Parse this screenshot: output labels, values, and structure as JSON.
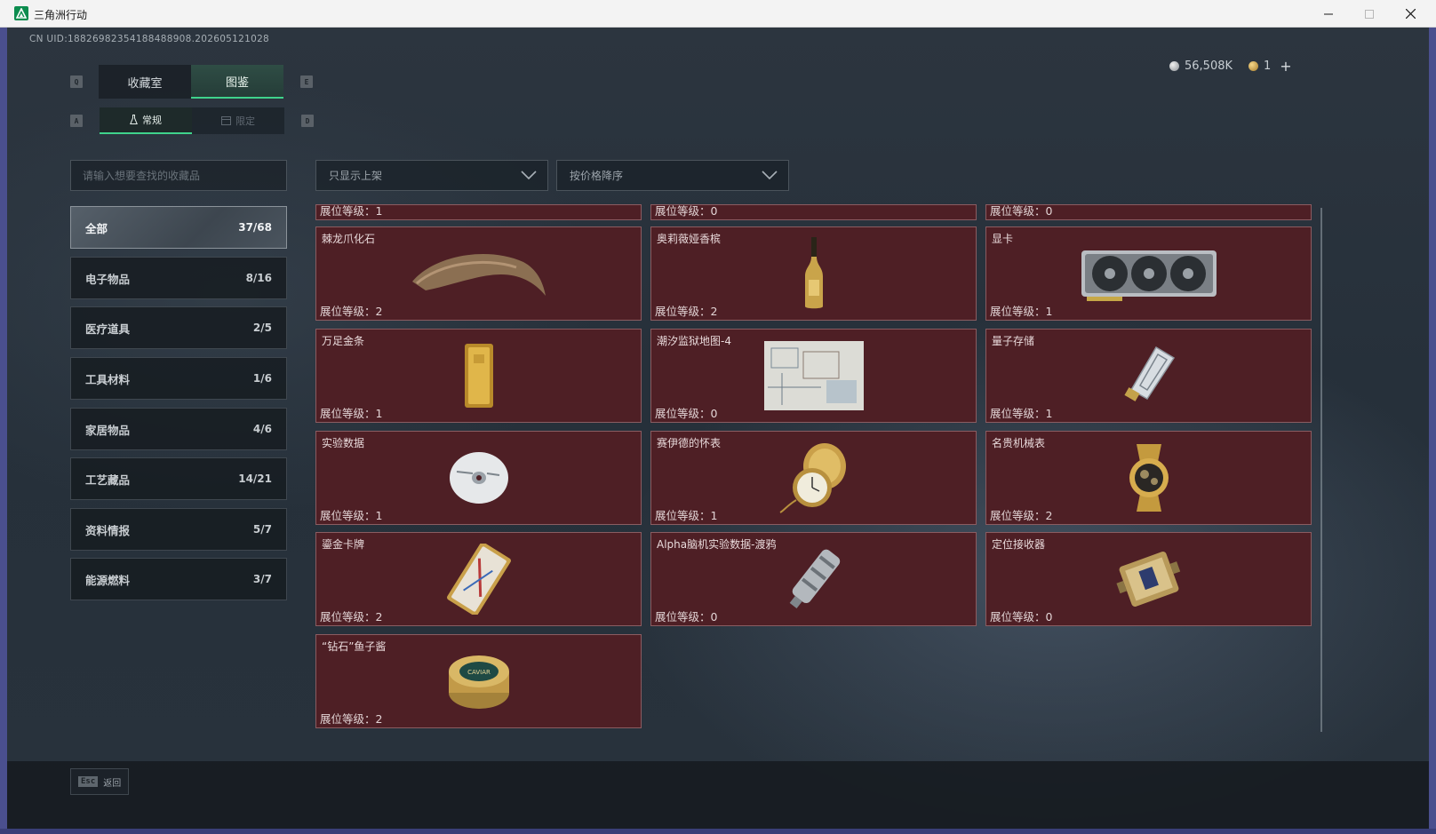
{
  "window": {
    "title": "三角洲行动"
  },
  "header": {
    "uid": "CN UID:18826982354188488908.202605121028",
    "currency_silver": "56,508K",
    "currency_gold": "1",
    "plus": "+"
  },
  "tabs": {
    "main": [
      {
        "label": "收藏室"
      },
      {
        "label": "图鉴"
      }
    ],
    "sub": [
      {
        "label": "常规"
      },
      {
        "label": "限定"
      }
    ],
    "keys": {
      "q": "Q",
      "e": "E",
      "a": "A",
      "d": "D"
    }
  },
  "search": {
    "placeholder": "请输入想要查找的收藏品"
  },
  "filters": {
    "display": "只显示上架",
    "sort": "按价格降序"
  },
  "categories": [
    {
      "label": "全部",
      "count": "37/68"
    },
    {
      "label": "电子物品",
      "count": "8/16"
    },
    {
      "label": "医疗道具",
      "count": "2/5"
    },
    {
      "label": "工具材料",
      "count": "1/6"
    },
    {
      "label": "家居物品",
      "count": "4/6"
    },
    {
      "label": "工艺藏品",
      "count": "14/21"
    },
    {
      "label": "资料情报",
      "count": "5/7"
    },
    {
      "label": "能源燃料",
      "count": "3/7"
    }
  ],
  "top_row_levels": [
    "展位等级：1",
    "展位等级：0",
    "展位等级：0"
  ],
  "items": [
    {
      "name": "棘龙爪化石",
      "level": "展位等级：2",
      "icon": "claw-fossil-icon"
    },
    {
      "name": "奥莉薇娅香槟",
      "level": "展位等级：2",
      "icon": "champagne-bottle-icon"
    },
    {
      "name": "显卡",
      "level": "展位等级：1",
      "icon": "graphics-card-icon"
    },
    {
      "name": "万足金条",
      "level": "展位等级：1",
      "icon": "gold-bar-icon"
    },
    {
      "name": "潮汐监狱地图-4",
      "level": "展位等级：0",
      "icon": "prison-map-icon"
    },
    {
      "name": "量子存储",
      "level": "展位等级：1",
      "icon": "quantum-storage-icon"
    },
    {
      "name": "实验数据",
      "level": "展位等级：1",
      "icon": "data-disc-icon"
    },
    {
      "name": "赛伊德的怀表",
      "level": "展位等级：1",
      "icon": "pocket-watch-icon"
    },
    {
      "name": "名贵机械表",
      "level": "展位等级：2",
      "icon": "wristwatch-icon"
    },
    {
      "name": "鎏金卡牌",
      "level": "展位等级：2",
      "icon": "gilded-card-icon"
    },
    {
      "name": "Alpha脑机实验数据-渡鸦",
      "level": "展位等级：0",
      "icon": "data-canister-icon"
    },
    {
      "name": "定位接收器",
      "level": "展位等级：0",
      "icon": "locator-receiver-icon"
    },
    {
      "name": "“钻石”鱼子酱",
      "level": "展位等级：2",
      "icon": "caviar-tin-icon"
    }
  ],
  "caviar_label": "CAVIAR",
  "footer": {
    "esc_key": "Esc",
    "back": "返回"
  },
  "colors": {
    "accent_green": "#3fd38c",
    "card_bg": "#4e1f25",
    "card_border": "#8a5c61"
  }
}
